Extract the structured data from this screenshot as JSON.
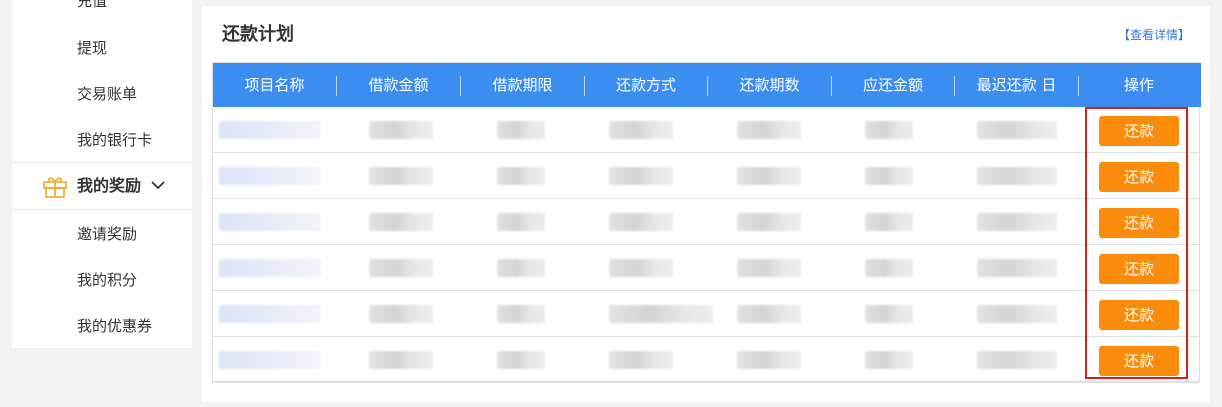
{
  "sidebar": {
    "items_top": [
      "充值",
      "提现",
      "交易账单",
      "我的银行卡"
    ],
    "group": {
      "label": "我的奖励",
      "icon": "gift-icon",
      "chevron": "chevron-down-icon"
    },
    "items_bottom": [
      "邀请奖励",
      "我的积分",
      "我的优惠券"
    ]
  },
  "panel": {
    "title": "还款计划",
    "detail_link": "【查看详情】"
  },
  "table": {
    "headers": [
      "项目名称",
      "借款金额",
      "借款期限",
      "还款方式",
      "还款期数",
      "应还金额",
      "最迟还款 日",
      "操作"
    ],
    "row_count": 6,
    "action_label": "还款"
  },
  "colors": {
    "header_bg": "#3b8df0",
    "button_bg": "#fb8c0b",
    "highlight_border": "#d9211c",
    "link": "#2f7bd7"
  }
}
